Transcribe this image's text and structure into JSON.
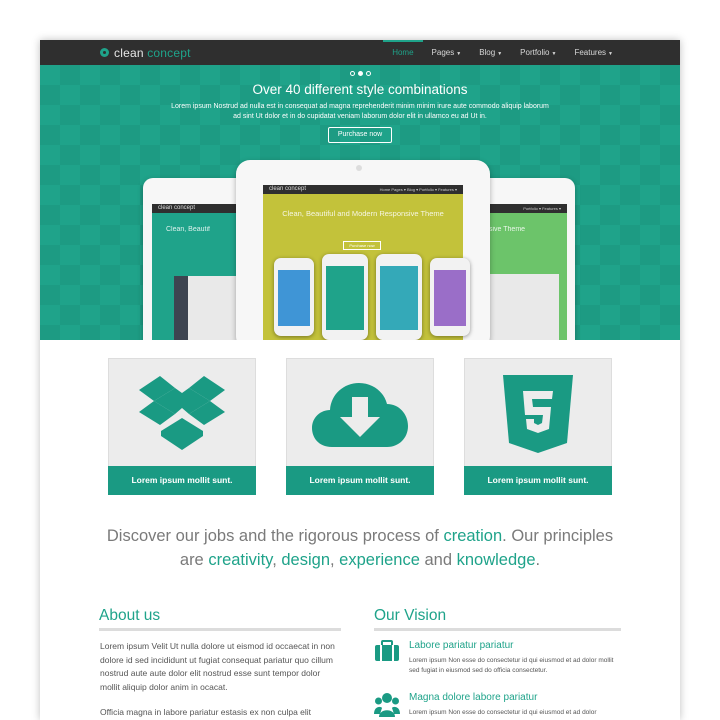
{
  "nav": {
    "logo_light": "clean",
    "logo_accent": "concept",
    "items": [
      {
        "label": "Home",
        "active": true,
        "dropdown": false
      },
      {
        "label": "Pages",
        "active": false,
        "dropdown": true
      },
      {
        "label": "Blog",
        "active": false,
        "dropdown": true
      },
      {
        "label": "Portfolio",
        "active": false,
        "dropdown": true
      },
      {
        "label": "Features",
        "active": false,
        "dropdown": true
      }
    ]
  },
  "hero": {
    "title": "Over 40 different style combinations",
    "subtitle": "Lorem ipsum Nostrud ad nulla est in consequat ad magna reprehenderit minim minim irure aute commodo aliquip laborum ad sint Ut dolor et in do cupidatat veniam laborum dolor elit in ullamco eu ad Ut in.",
    "button": "Purchase now",
    "slide_count": 3,
    "active_slide": 1,
    "mockup": {
      "logo": "clean concept",
      "menu": "Home   Pages ▾   Blog ▾   Portfolio ▾   Features ▾",
      "title_center": "Clean, Beautiful and Modern Responsive Theme",
      "title_left": "Clean, Beautif",
      "title_right": "sive Theme",
      "button": "Purchase now",
      "right_menu": "Portfolio ▾   Features ▾"
    }
  },
  "features": [
    {
      "icon": "dropbox-icon",
      "label": "Lorem ipsum mollit sunt."
    },
    {
      "icon": "cloud-download-icon",
      "label": "Lorem ipsum mollit sunt."
    },
    {
      "icon": "html5-icon",
      "label": "Lorem ipsum mollit sunt."
    }
  ],
  "tagline": {
    "part1": "Discover our jobs and the rigorous process of ",
    "w1": "creation",
    "part2": ". Our principles are ",
    "w2": "creativity",
    "sep1": ", ",
    "w3": "design",
    "sep2": ", ",
    "w4": "experience",
    "part3": " and ",
    "w5": "knowledge",
    "end": "."
  },
  "about": {
    "title": "About us",
    "p1": "Lorem ipsum Velit Ut nulla dolore ut eismod id occaecat in non dolore id sed incididunt ut fugiat consequat pariatur quo cillum nostrud aute aute dolor elit nostrud esse sunt tempor dolor mollit aliquip dolor anim in ocacat.",
    "p2": "Officia magna in labore pariatur estasis ex non culpa elit"
  },
  "vision": {
    "title": "Our Vision",
    "items": [
      {
        "icon": "briefcase-icon",
        "title": "Labore pariatur pariatur",
        "text": "Lorem ipsum Non esse do consectetur id qui eiusmod et ad dolor mollit sed fugiat in eiusmod sed do officia consectetur."
      },
      {
        "icon": "users-icon",
        "title": "Magna dolore labore pariatur",
        "text": "Lorem ipsum Non esse do consectetur id qui eiusmod et ad dolor"
      }
    ]
  },
  "colors": {
    "accent": "#1fa38a",
    "nav_bg": "#2f2f2f",
    "feature_bar": "#1a9a83"
  }
}
